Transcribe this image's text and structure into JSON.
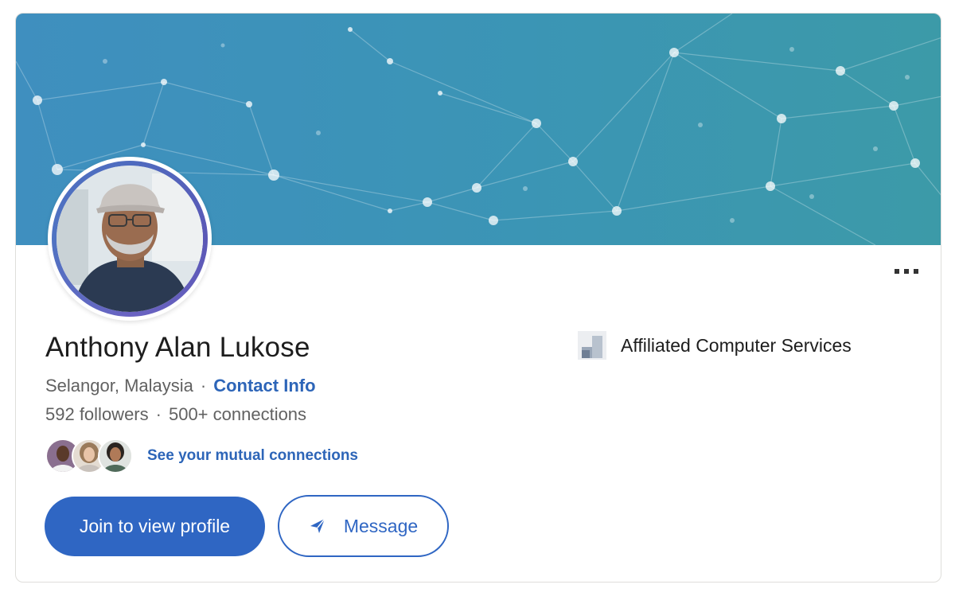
{
  "profile": {
    "name": "Anthony Alan Lukose",
    "location": "Selangor, Malaysia",
    "separator": "·",
    "contact_label": "Contact Info",
    "followers": "592 followers",
    "connections": "500+ connections",
    "mutual_label": "See your mutual connections"
  },
  "company": {
    "name": "Affiliated Computer Services",
    "logo_icon": "company-logo-icon"
  },
  "actions": {
    "join_label": "Join to view profile",
    "message_label": "Message",
    "message_icon": "send-icon",
    "more_icon": "more-options-icon"
  },
  "colors": {
    "accent": "#2f66c3",
    "banner_start": "#3f8fbf",
    "banner_end": "#3c9aa8",
    "link": "#2d65b8"
  }
}
